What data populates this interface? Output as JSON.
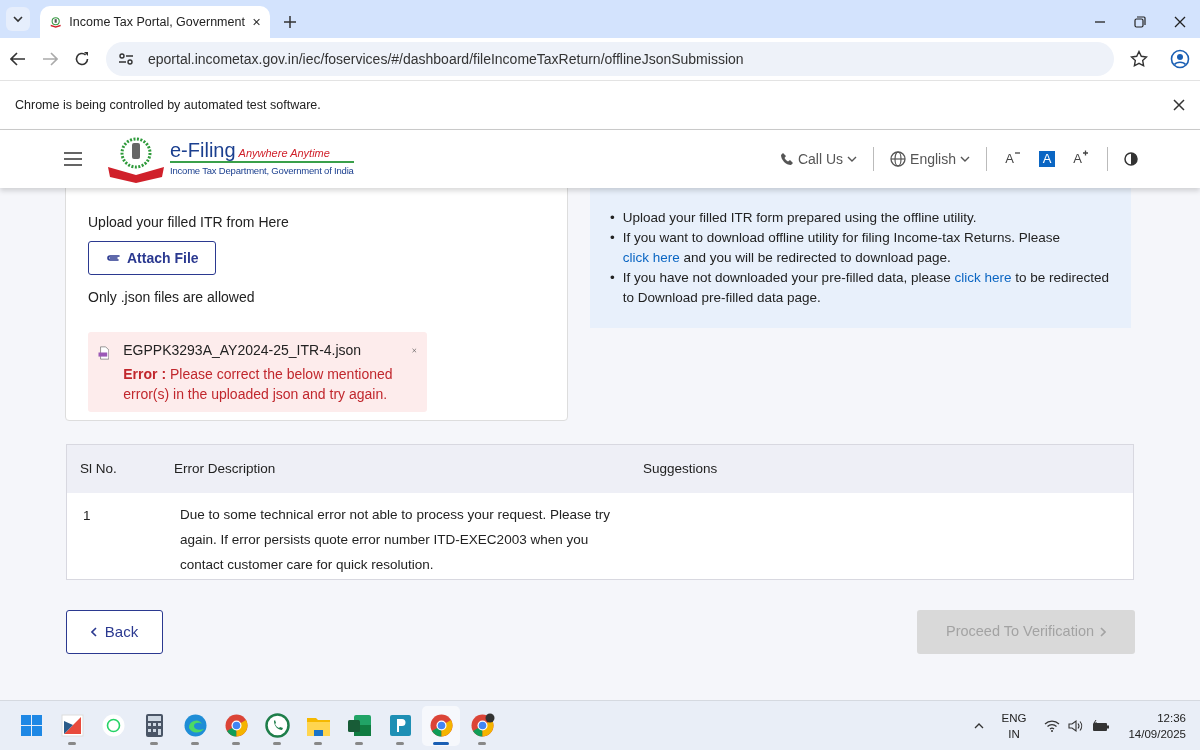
{
  "browser": {
    "tab_title": "Income Tax Portal, Government",
    "url": "eportal.incometax.gov.in/iec/foservices/#/dashboard/fileIncomeTaxReturn/offlineJsonSubmission",
    "infobar": "Chrome is being controlled by automated test software."
  },
  "header": {
    "brand": "e-Filing",
    "tagline": "Anywhere Anytime",
    "department": "Income Tax Department, Government of India",
    "call_us": "Call Us",
    "language": "English",
    "font_controls": [
      {
        "label": "A",
        "kind": "decrease",
        "selected": false
      },
      {
        "label": "A",
        "kind": "normal",
        "selected": true
      },
      {
        "label": "A",
        "kind": "increase",
        "selected": false
      }
    ]
  },
  "upload": {
    "instruction": "Upload your filled ITR from Here",
    "attach_button": "Attach File",
    "note": "Only .json files are allowed",
    "file": {
      "name": "EGPPK3293A_AY2024-25_ITR-4.json",
      "error_label": "Error :",
      "error_message": "Please correct the below mentioned error(s) in the uploaded json and try again."
    }
  },
  "info": [
    {
      "marker": "•",
      "parts": [
        {
          "text": "Upload your filled ITR form prepared using the offline utility."
        }
      ]
    },
    {
      "marker": "•",
      "parts": [
        {
          "text": "If you want to download offline utility for filing Income-tax Returns. Please "
        },
        {
          "text": "click here",
          "kind": "link"
        },
        {
          "text": " and you will be redirected to download page."
        }
      ]
    },
    {
      "marker": "•",
      "parts": [
        {
          "text": "If you have not downloaded your pre-filled data, please "
        },
        {
          "text": "click here",
          "kind": "link"
        },
        {
          "text": " to be redirected to Download pre-filled data page."
        }
      ]
    }
  ],
  "table": {
    "columns": [
      "Sl No.",
      "Error Description",
      "Suggestions"
    ],
    "rows": [
      {
        "sl": "1",
        "description": "Due to some technical error not able to process your request. Please try again. If error persists quote error number ITD-EXEC2003 when you contact customer care for quick resolution."
      }
    ]
  },
  "actions": {
    "back": "Back",
    "proceed": {
      "label": "Proceed To Verification",
      "disabled": true
    }
  },
  "taskbar": {
    "apps": [
      {
        "kind": "start",
        "selected": false
      },
      {
        "kind": "tile",
        "selected": false
      },
      {
        "kind": "chat-light",
        "selected": false
      },
      {
        "kind": "calculator",
        "selected": false
      },
      {
        "kind": "edge",
        "selected": false
      },
      {
        "kind": "chrome",
        "selected": false
      },
      {
        "kind": "chat",
        "selected": false
      },
      {
        "kind": "folder",
        "selected": false
      },
      {
        "kind": "sheet",
        "selected": false
      },
      {
        "kind": "p-app",
        "selected": false
      },
      {
        "kind": "chrome",
        "selected": true
      },
      {
        "kind": "chrome-profile",
        "selected": false
      }
    ],
    "language": "ENG",
    "region": "IN",
    "time": "12:36",
    "date": "14/09/2025"
  }
}
